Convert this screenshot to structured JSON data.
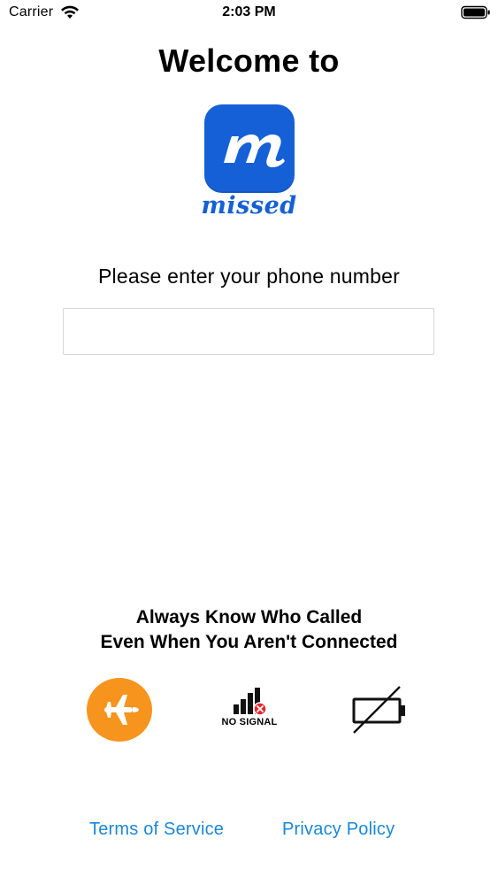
{
  "status_bar": {
    "carrier": "Carrier",
    "time": "2:03 PM",
    "icons": [
      "wifi-icon",
      "battery-icon"
    ]
  },
  "welcome": {
    "title": "Welcome to",
    "logo_letter": "m",
    "logo_wordmark": "missed",
    "brand_color": "#1560d6"
  },
  "phone": {
    "prompt": "Please enter your phone number",
    "value": "",
    "placeholder": ""
  },
  "tagline": {
    "line1": "Always Know Who Called",
    "line2": "Even When You Aren't Connected"
  },
  "features": [
    {
      "icon": "airplane-mode-icon",
      "color": "#f7941d"
    },
    {
      "icon": "no-signal-icon",
      "label": "NO SIGNAL",
      "accent": "#e8262c"
    },
    {
      "icon": "dead-battery-icon"
    }
  ],
  "footer": {
    "terms": "Terms of Service",
    "privacy": "Privacy Policy",
    "link_color": "#1a87d6"
  }
}
